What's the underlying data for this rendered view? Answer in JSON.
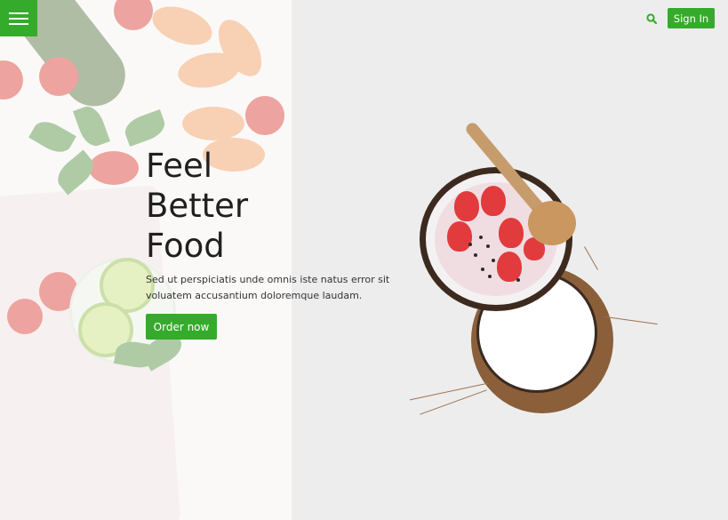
{
  "header": {
    "menu_icon": "hamburger-menu-icon",
    "search_icon": "search-icon",
    "signin_label": "Sign In"
  },
  "hero": {
    "title_lines": [
      "Feel",
      "Better",
      "Food"
    ],
    "description": "Sed ut perspiciatis unde omnis iste natus error sit voluatem accusantium doloremque laudam.",
    "cta_label": "Order now"
  },
  "colors": {
    "accent": "#35ab2b",
    "text": "#1f1f1f",
    "background": "#ededed"
  }
}
